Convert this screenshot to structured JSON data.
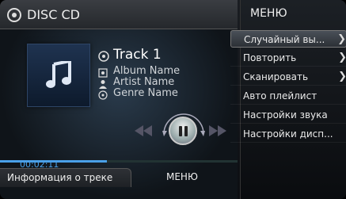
{
  "source": {
    "title": "DISC CD",
    "icon": "disc-icon"
  },
  "track": {
    "title": "Track 1",
    "album": "Album Name",
    "artist": "Artist Name",
    "genre": "Genre Name",
    "time": "00:02:11",
    "progress": 0.45
  },
  "controls": {
    "prev_icon": "rewind-icon",
    "play_icon": "pause-icon",
    "next_icon": "fast-forward-icon"
  },
  "bottom_tabs": {
    "info": "Информация о треке",
    "menu": "МЕНЮ"
  },
  "menu": {
    "header": "МЕНЮ",
    "items": [
      {
        "label": "Случайный вы...",
        "has_submenu": true,
        "selected": true
      },
      {
        "label": "Повторить",
        "has_submenu": true,
        "selected": false
      },
      {
        "label": "Сканировать",
        "has_submenu": true,
        "selected": false
      },
      {
        "label": "Авто плейлист",
        "has_submenu": false,
        "selected": false
      },
      {
        "label": "Настройки звука",
        "has_submenu": false,
        "selected": false
      },
      {
        "label": "Настройки дисп...",
        "has_submenu": false,
        "selected": false
      }
    ]
  },
  "colors": {
    "accent": "#4aa0e8",
    "background": "#0c0e12"
  }
}
